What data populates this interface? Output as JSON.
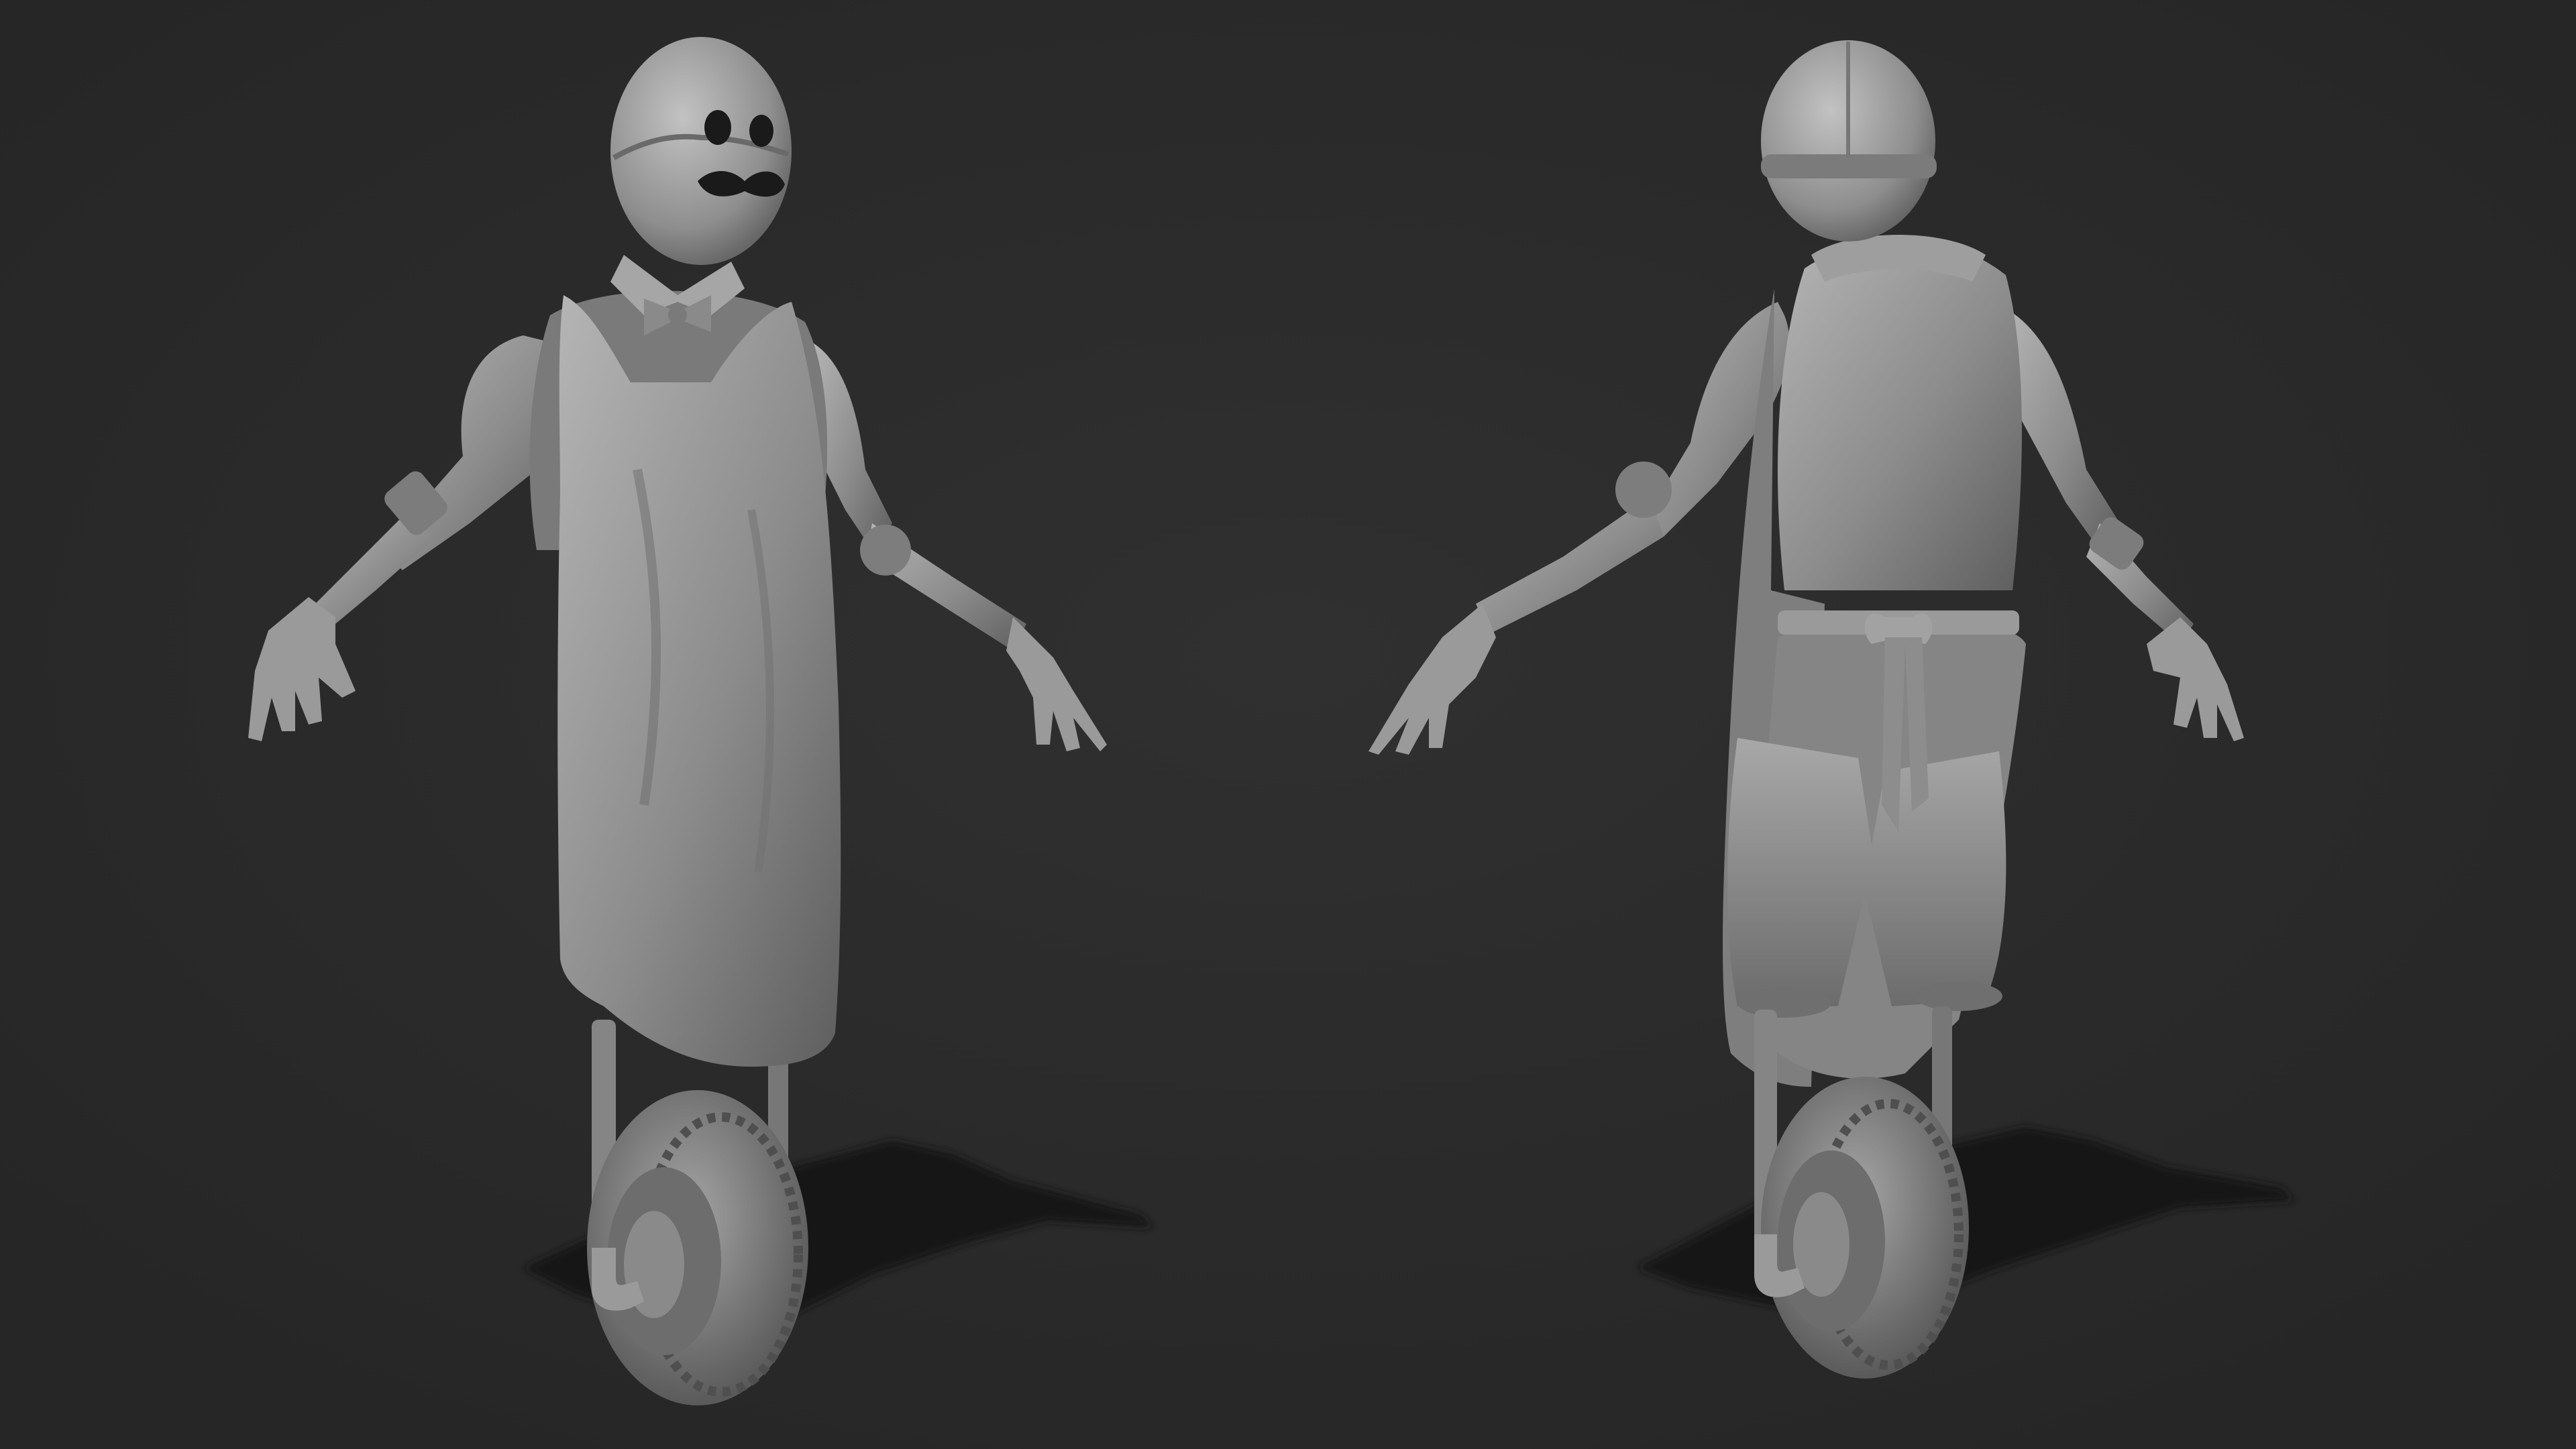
{
  "scene": {
    "background_color": "#2b2b2b",
    "material_base_color": "#8f8f8f",
    "material_highlight_color": "#c4c4c4",
    "material_shadow_color": "#505050",
    "ground_shadow_color": "#111111",
    "figures": [
      {
        "view": "front",
        "features": [
          "egg-head",
          "eyes",
          "mustache",
          "bow-tie",
          "apron",
          "robotic-arms",
          "unicycle-wheel"
        ]
      },
      {
        "view": "back",
        "features": [
          "egg-head",
          "helmet-seam",
          "apron-tie",
          "shorts",
          "robotic-arms",
          "unicycle-wheel"
        ]
      }
    ]
  }
}
